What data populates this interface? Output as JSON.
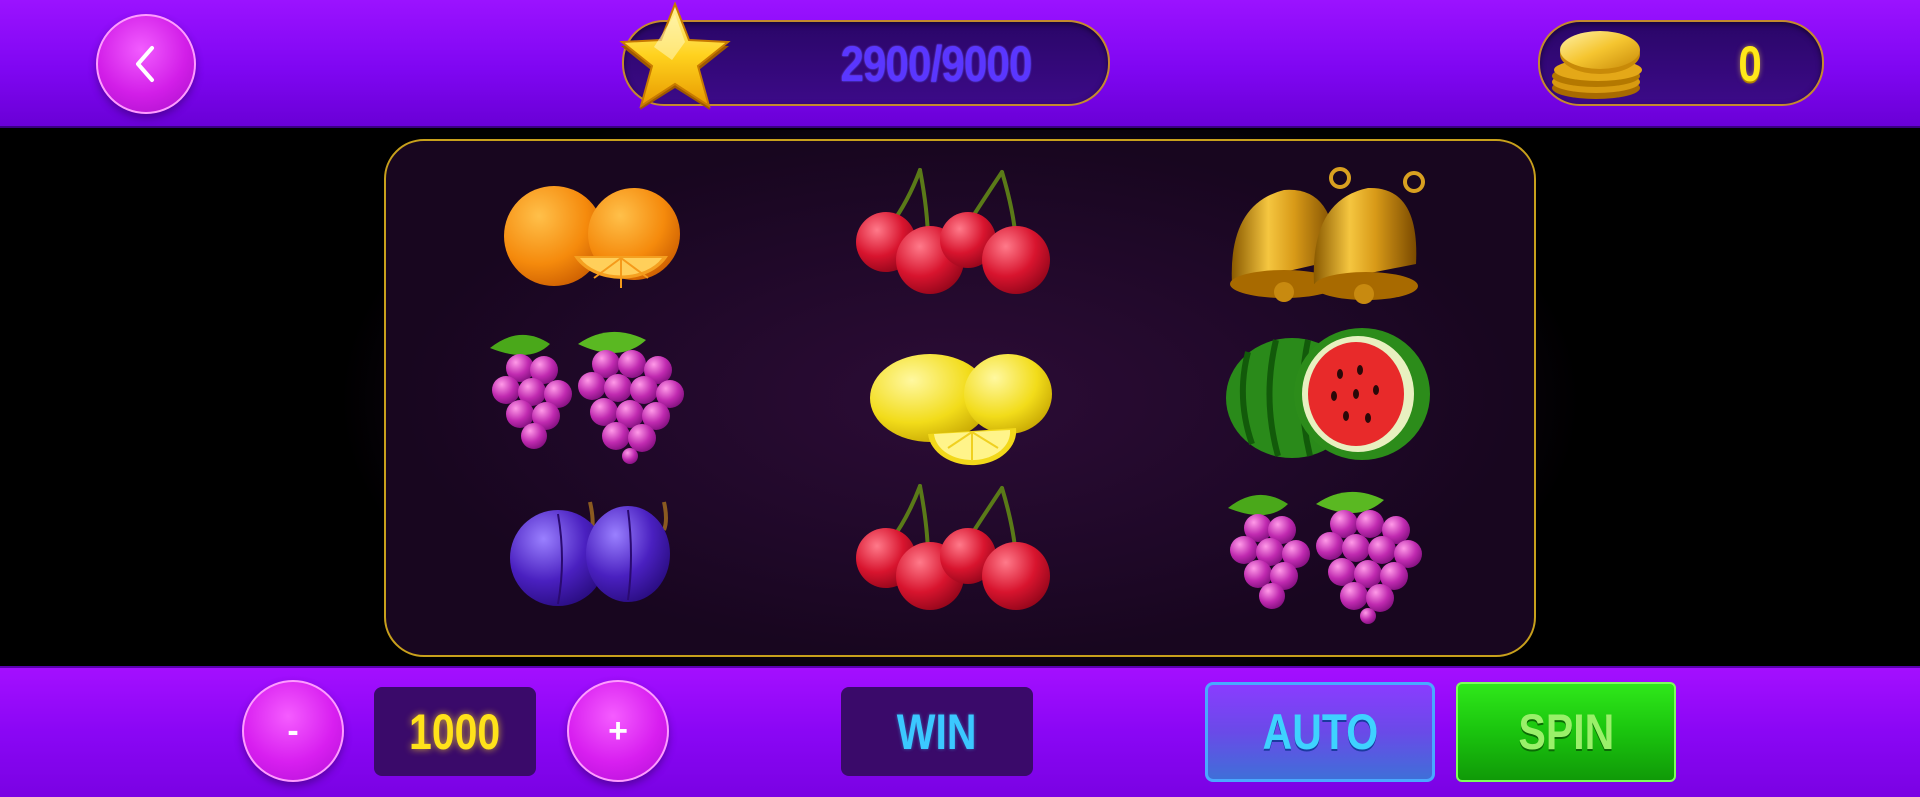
{
  "header": {
    "back_icon": "chevron-left-icon",
    "xp_progress": "2900/9000",
    "xp_icon": "star-icon",
    "coin_balance": "0",
    "coin_icon": "coin-stack-icon"
  },
  "reels": [
    [
      "orange",
      "cherry",
      "bell"
    ],
    [
      "grape",
      "lemon",
      "watermelon"
    ],
    [
      "plum",
      "cherry",
      "grape"
    ]
  ],
  "controls": {
    "minus_label": "-",
    "bet_value": "1000",
    "plus_label": "+",
    "win_label": "WIN",
    "auto_label": "AUTO",
    "spin_label": "SPIN"
  },
  "colors": {
    "header_bg": "#8a08f5",
    "bet_text": "#ffe21a",
    "win_text": "#3bc8ff",
    "spin_bg": "#1ac40e",
    "auto_bg": "#6a4ae8",
    "frame_border": "#c8a01c"
  }
}
